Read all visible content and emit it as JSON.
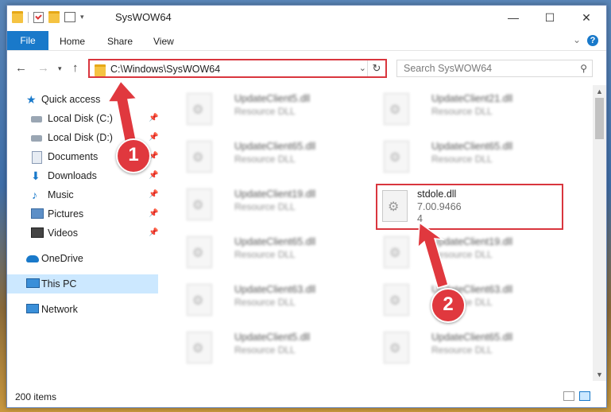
{
  "window": {
    "title": "SysWOW64",
    "controls": {
      "minimize": "—",
      "maximize": "☐",
      "close": "✕"
    }
  },
  "ribbon": {
    "tabs": [
      "File",
      "Home",
      "Share",
      "View"
    ],
    "help": "?"
  },
  "navigation": {
    "address": "C:\\Windows\\SysWOW64",
    "search_placeholder": "Search SysWOW64"
  },
  "sidebar": {
    "items": [
      {
        "label": "Quick access",
        "icon": "star-icon"
      },
      {
        "label": "Local Disk (C:)",
        "icon": "drive-icon",
        "pinned": true
      },
      {
        "label": "Local Disk (D:)",
        "icon": "drive-icon",
        "pinned": true
      },
      {
        "label": "Documents",
        "icon": "documents-icon",
        "pinned": true
      },
      {
        "label": "Downloads",
        "icon": "downloads-icon",
        "pinned": true
      },
      {
        "label": "Music",
        "icon": "music-icon",
        "pinned": true
      },
      {
        "label": "Pictures",
        "icon": "pictures-icon",
        "pinned": true
      },
      {
        "label": "Videos",
        "icon": "videos-icon",
        "pinned": true
      },
      {
        "label": "OneDrive",
        "icon": "onedrive-icon"
      },
      {
        "label": "This PC",
        "icon": "this-pc-icon",
        "selected": true
      },
      {
        "label": "Network",
        "icon": "network-icon"
      }
    ]
  },
  "files": {
    "col1": [
      {
        "name": "UpdateClient5.dll",
        "type": "Resource DLL"
      },
      {
        "name": "UpdateClient65.dll",
        "type": "Resource DLL"
      },
      {
        "name": "UpdateClient19.dll",
        "type": "Resource DLL"
      },
      {
        "name": "UpdateClient65.dll",
        "type": "Resource DLL"
      },
      {
        "name": "UpdateClient63.dll",
        "type": "Resource DLL"
      },
      {
        "name": "UpdateClient5.dll",
        "type": "Resource DLL"
      }
    ],
    "col2": [
      {
        "name": "UpdateClient21.dll",
        "type": "Resource DLL"
      },
      {
        "name": "UpdateClient65.dll",
        "type": "Resource DLL"
      },
      {
        "name": "UpdateClient19.dll",
        "type": "Resource DLL"
      },
      {
        "name": "UpdateClient63.dll",
        "type": "Resource DLL"
      },
      {
        "name": "UpdateClient65.dll",
        "type": "Resource DLL"
      }
    ],
    "highlighted": {
      "name": "stdole.dll",
      "version": "7.00.9466",
      "size": "4"
    }
  },
  "status": {
    "item_count": "200 items"
  },
  "callouts": {
    "step1": "1",
    "step2": "2"
  },
  "colors": {
    "accent": "#1979ca",
    "highlight": "#d9363e",
    "selection": "#cce8ff"
  }
}
